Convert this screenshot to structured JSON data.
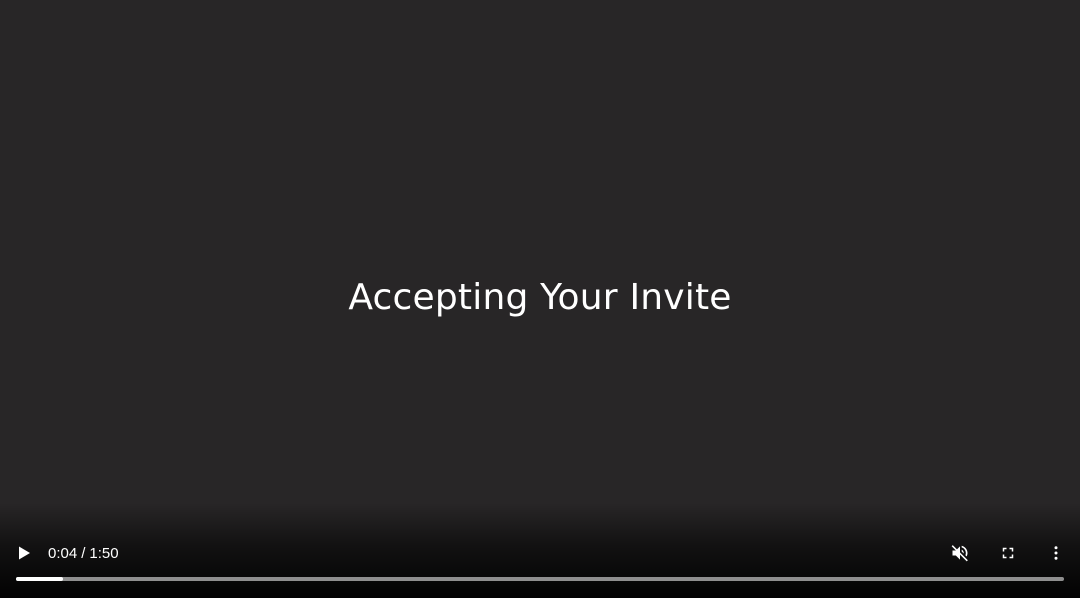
{
  "video": {
    "title": "Accepting Your Invite"
  },
  "controls": {
    "play_icon": "play-icon",
    "current_time": "0:04",
    "separator": "/",
    "duration": "1:50",
    "mute_icon": "volume-muted-icon",
    "fullscreen_icon": "fullscreen-icon",
    "more_icon": "more-vertical-icon",
    "progress_fraction": 0.045
  },
  "colors": {
    "background": "#282627",
    "text": "#ffffff",
    "progress_fill": "#ffffff"
  }
}
